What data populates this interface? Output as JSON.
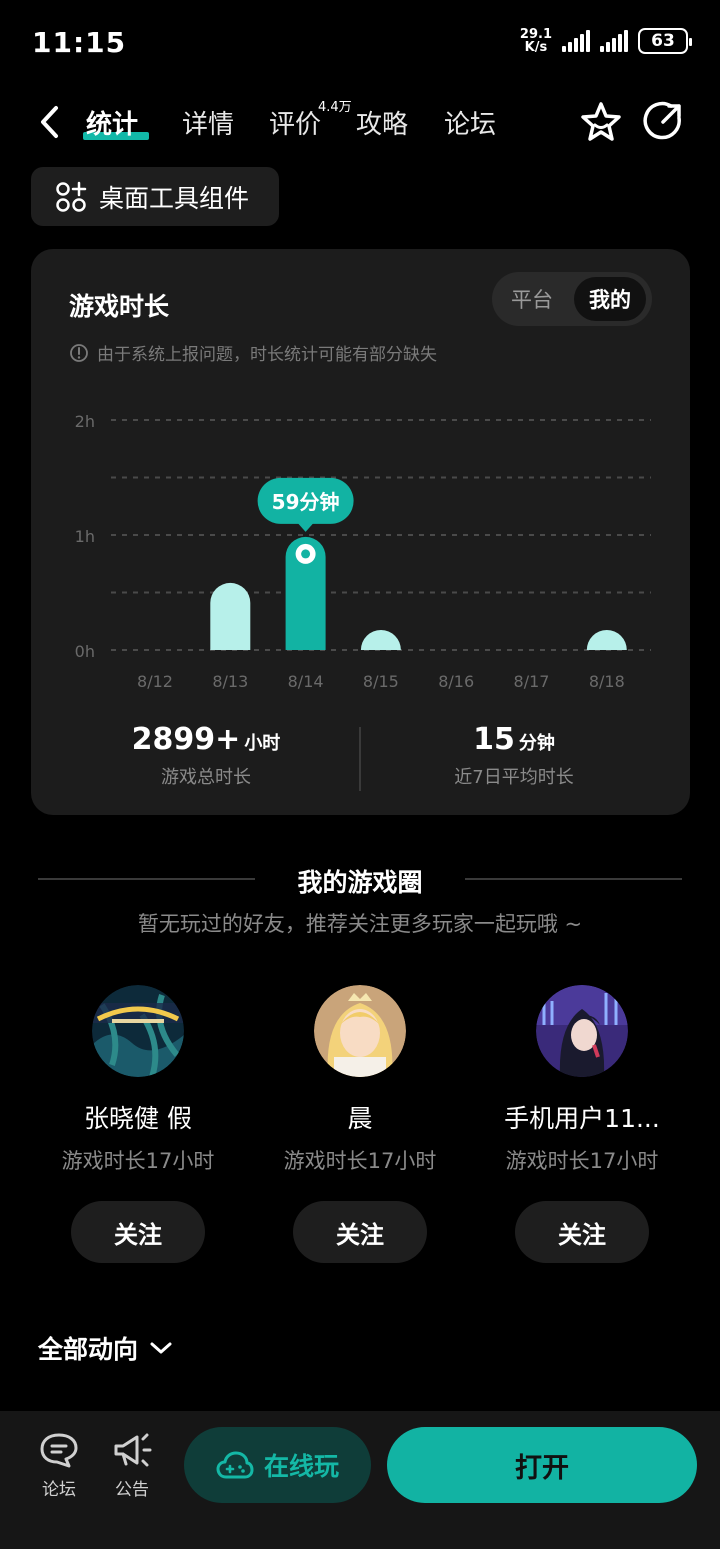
{
  "status": {
    "time": "11:15",
    "net_speed_value": "29.1",
    "net_speed_unit": "K/s",
    "battery": "63"
  },
  "nav": {
    "tabs": [
      {
        "label": "统计",
        "active": true
      },
      {
        "label": "详情",
        "active": false
      },
      {
        "label": "评价",
        "active": false
      },
      {
        "label": "攻略",
        "active": false
      },
      {
        "label": "论坛",
        "active": false
      }
    ],
    "review_count": "4.4万"
  },
  "widget_button": "桌面工具组件",
  "playtime": {
    "title": "游戏时长",
    "segment": [
      "平台",
      "我的"
    ],
    "notice": "由于系统上报问题，时长统计可能有部分缺失",
    "tooltip": "59分钟",
    "total": {
      "value": "2899+",
      "unit": "小时",
      "label": "游戏总时长"
    },
    "average": {
      "value": "15",
      "unit": "分钟",
      "label": "近7日平均时长"
    }
  },
  "chart_data": {
    "type": "bar",
    "categories": [
      "8/12",
      "8/13",
      "8/14",
      "8/15",
      "8/16",
      "8/17",
      "8/18"
    ],
    "values": [
      0,
      35,
      59,
      2,
      0,
      0,
      6
    ],
    "ylim": [
      0,
      120
    ],
    "yticks": [
      {
        "value": 0,
        "label": "0h"
      },
      {
        "value": 60,
        "label": "1h"
      },
      {
        "value": 120,
        "label": "2h"
      }
    ],
    "highlight_index": 2,
    "grid": true,
    "colors": {
      "bar": "#b7f0ea",
      "bar_active": "#12b3a3"
    }
  },
  "circle": {
    "title": "我的游戏圈",
    "subtitle": "暂无玩过的好友，推荐关注更多玩家一起玩哦 ~",
    "users": [
      {
        "name": "张晓健 假",
        "playtime": "游戏时长17小时",
        "follow": "关注"
      },
      {
        "name": "晨",
        "playtime": "游戏时长17小时",
        "follow": "关注"
      },
      {
        "name": "手机用户11...",
        "playtime": "游戏时长17小时",
        "follow": "关注"
      }
    ]
  },
  "all_activity": "全部动向",
  "bottom_bar": {
    "forum": "论坛",
    "announcement": "公告",
    "cloud_play": "在线玩",
    "open": "打开"
  },
  "colors": {
    "accent": "#12b3a3",
    "background": "#000000",
    "card": "#1c1c1c"
  }
}
